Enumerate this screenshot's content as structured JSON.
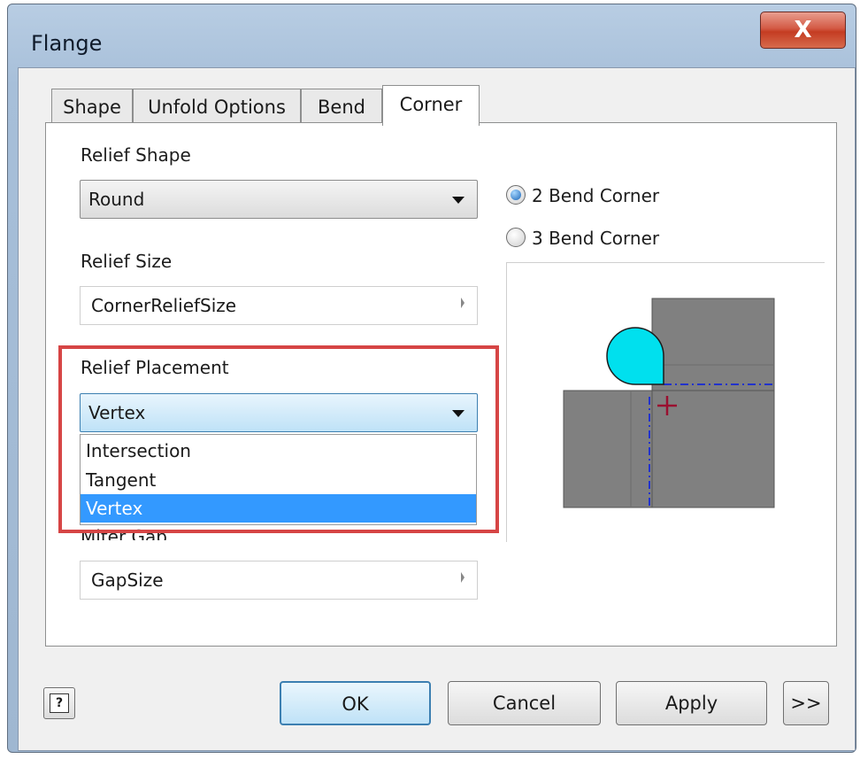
{
  "window": {
    "title": "Flange",
    "close_label": "X"
  },
  "tabs": [
    {
      "label": "Shape",
      "active": false
    },
    {
      "label": "Unfold Options",
      "active": false
    },
    {
      "label": "Bend",
      "active": false
    },
    {
      "label": "Corner",
      "active": true
    }
  ],
  "relief_shape": {
    "label": "Relief Shape",
    "value": "Round"
  },
  "relief_size": {
    "label": "Relief Size",
    "value": "CornerReliefSize"
  },
  "relief_placement": {
    "label": "Relief Placement",
    "value": "Vertex",
    "options": [
      "Intersection",
      "Tangent",
      "Vertex"
    ],
    "selected_index": 2
  },
  "miter_gap": {
    "label": "Miter Gap",
    "value": "GapSize"
  },
  "corner_type": {
    "options": [
      {
        "label": "2 Bend Corner",
        "checked": true
      },
      {
        "label": "3 Bend Corner",
        "checked": false
      }
    ]
  },
  "buttons": {
    "ok": "OK",
    "cancel": "Cancel",
    "apply": "Apply",
    "more": ">>",
    "help": "?"
  },
  "colors": {
    "highlight": "#d64545",
    "relief_fill": "#00e0ee",
    "selection": "#3399ff",
    "preview_gray": "#808080"
  }
}
